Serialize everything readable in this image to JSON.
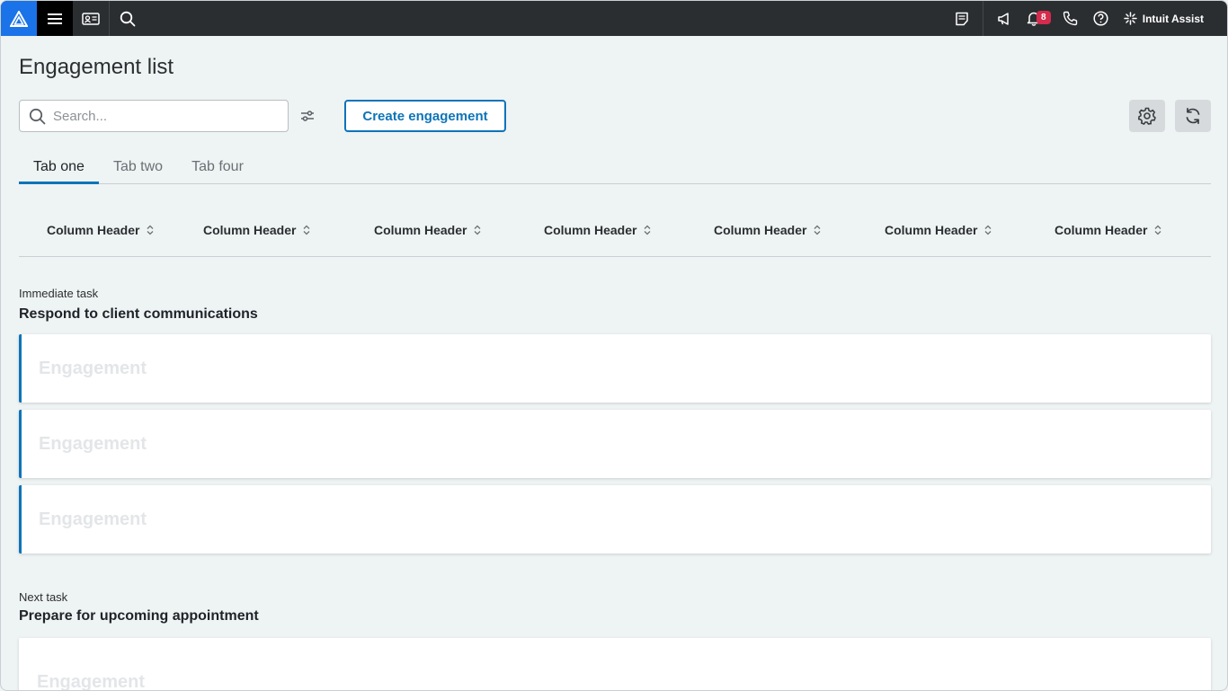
{
  "topbar": {
    "notification_count": "8",
    "assist_label": "Intuit Assist"
  },
  "page": {
    "title": "Engagement list"
  },
  "search": {
    "placeholder": "Search..."
  },
  "toolbar": {
    "create_label": "Create engagement"
  },
  "tabs": [
    {
      "label": "Tab one",
      "active": true
    },
    {
      "label": "Tab two",
      "active": false
    },
    {
      "label": "Tab four",
      "active": false
    }
  ],
  "columns": [
    "Column Header",
    "Column Header",
    "Column Header",
    "Column Header",
    "Column Header",
    "Column Header",
    "Column Header"
  ],
  "sections": [
    {
      "label": "Immediate task",
      "title": "Respond to client communications",
      "cards": [
        "Engagement",
        "Engagement",
        "Engagement"
      ]
    },
    {
      "label": "Next task",
      "title": "Prepare for upcoming appointment",
      "cards": [
        "Engagement"
      ]
    }
  ],
  "colors": {
    "accent": "#0d74b9",
    "topbar": "#2b2e31",
    "logo_bg": "#1a73e8",
    "badge": "#d52b4d"
  }
}
